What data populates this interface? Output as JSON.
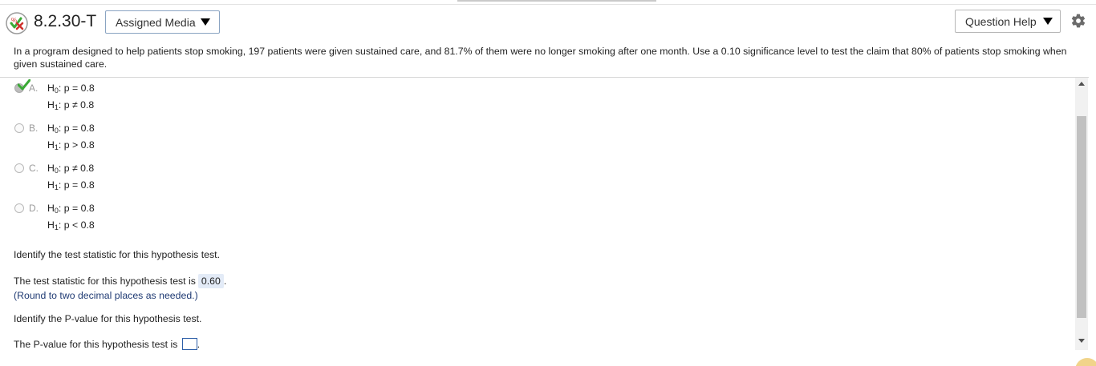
{
  "header": {
    "question_id": "8.2.30-T",
    "assigned_media_label": "Assigned Media",
    "question_help_label": "Question Help",
    "status_icon": "partial-credit-icon",
    "settings_icon": "gear-icon"
  },
  "problem": {
    "text": "In a program designed to help patients stop smoking, 197 patients were given sustained care, and 81.7% of them were no longer smoking after one month. Use a 0.10 significance level to test the claim that 80% of patients stop smoking when given sustained care."
  },
  "options": [
    {
      "letter": "A.",
      "h0_rel": "p = 0.8",
      "h1_rel": "p ≠ 0.8",
      "selected": true,
      "correct": true
    },
    {
      "letter": "B.",
      "h0_rel": "p = 0.8",
      "h1_rel": "p > 0.8",
      "selected": false,
      "correct": false
    },
    {
      "letter": "C.",
      "h0_rel": "p ≠ 0.8",
      "h1_rel": "p = 0.8",
      "selected": false,
      "correct": false
    },
    {
      "letter": "D.",
      "h0_rel": "p = 0.8",
      "h1_rel": "p < 0.8",
      "selected": false,
      "correct": false
    }
  ],
  "hyp": {
    "h": "H",
    "sub0": "0",
    "sub1": "1",
    "colon": ":"
  },
  "part2": {
    "prompt": "Identify the test statistic for this hypothesis test.",
    "answer_prefix": "The test statistic for this hypothesis test is",
    "answer_value": "0.60",
    "answer_suffix": ".",
    "hint": "(Round to two decimal places as needed.)"
  },
  "part3": {
    "prompt": "Identify the P-value for this hypothesis test.",
    "answer_prefix": "The P-value for this hypothesis test is",
    "answer_suffix": "."
  },
  "colors": {
    "link_blue": "#1f3a73",
    "answer_bg": "#e3ebf7",
    "correct_green": "#3aa935",
    "wrong_red": "#d0312d"
  }
}
